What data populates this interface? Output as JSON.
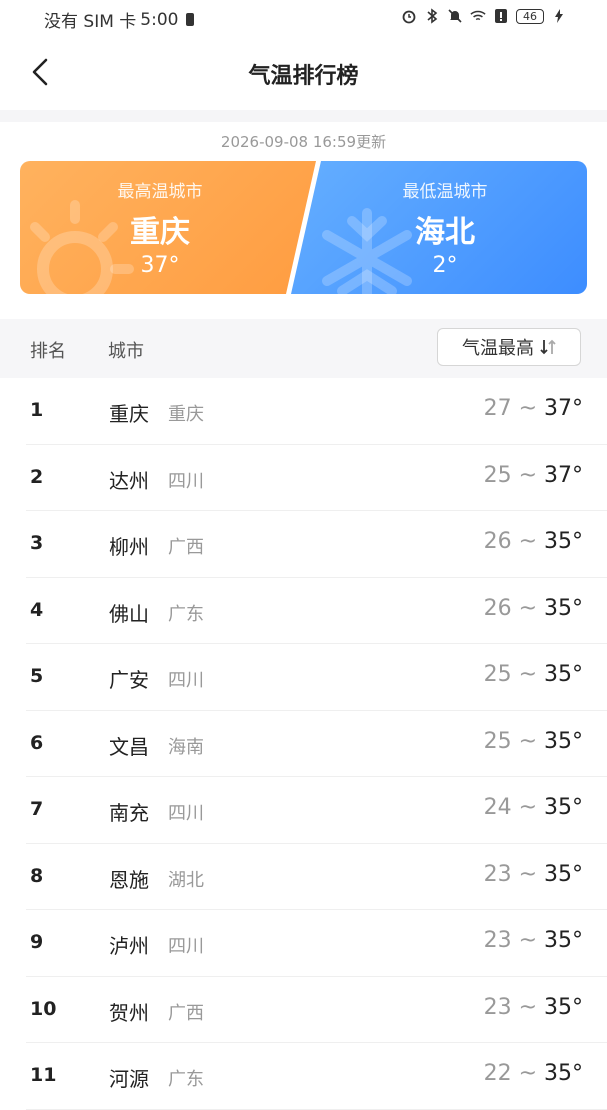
{
  "status_bar": {
    "carrier": "没有 SIM 卡",
    "time": "5:00",
    "battery": "46"
  },
  "header": {
    "title": "气温排行榜"
  },
  "updated_text": "2026-09-08 16:59更新",
  "summary": {
    "hot": {
      "label": "最高温城市",
      "city": "重庆",
      "temp": "37°"
    },
    "cold": {
      "label": "最低温城市",
      "city": "海北",
      "temp": "2°"
    }
  },
  "table": {
    "col_rank": "排名",
    "col_city": "城市",
    "sort_label": "气温最高",
    "rows": [
      {
        "rank": "1",
        "city": "重庆",
        "province": "重庆",
        "low": "27",
        "high": "37°"
      },
      {
        "rank": "2",
        "city": "达州",
        "province": "四川",
        "low": "25",
        "high": "37°"
      },
      {
        "rank": "3",
        "city": "柳州",
        "province": "广西",
        "low": "26",
        "high": "35°"
      },
      {
        "rank": "4",
        "city": "佛山",
        "province": "广东",
        "low": "26",
        "high": "35°"
      },
      {
        "rank": "5",
        "city": "广安",
        "province": "四川",
        "low": "25",
        "high": "35°"
      },
      {
        "rank": "6",
        "city": "文昌",
        "province": "海南",
        "low": "25",
        "high": "35°"
      },
      {
        "rank": "7",
        "city": "南充",
        "province": "四川",
        "low": "24",
        "high": "35°"
      },
      {
        "rank": "8",
        "city": "恩施",
        "province": "湖北",
        "low": "23",
        "high": "35°"
      },
      {
        "rank": "9",
        "city": "泸州",
        "province": "四川",
        "low": "23",
        "high": "35°"
      },
      {
        "rank": "10",
        "city": "贺州",
        "province": "广西",
        "low": "23",
        "high": "35°"
      },
      {
        "rank": "11",
        "city": "河源",
        "province": "广东",
        "low": "22",
        "high": "35°"
      }
    ]
  },
  "colors": {
    "hot_gradient_start": "#ffb25e",
    "hot_gradient_end": "#ff8f2e",
    "cold_gradient_start": "#7ec4ff",
    "cold_gradient_end": "#3d8dff"
  }
}
